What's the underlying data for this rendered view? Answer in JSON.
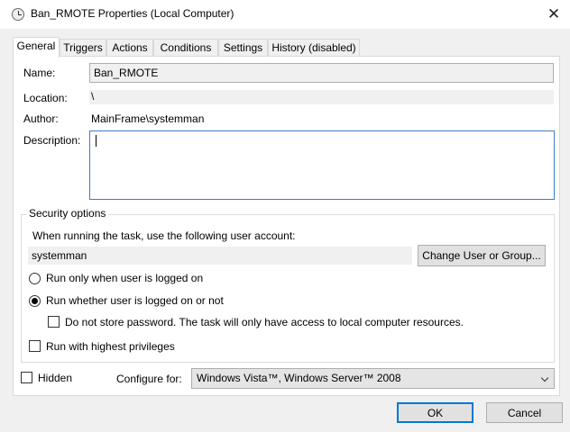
{
  "window": {
    "title": "Ban_RMOTE Properties (Local Computer)",
    "close_glyph": "✕",
    "icon": "scheduled-task-clock-icon"
  },
  "tabs": [
    {
      "label": "General",
      "active": true
    },
    {
      "label": "Triggers",
      "active": false
    },
    {
      "label": "Actions",
      "active": false
    },
    {
      "label": "Conditions",
      "active": false
    },
    {
      "label": "Settings",
      "active": false
    },
    {
      "label": "History (disabled)",
      "active": false
    }
  ],
  "general": {
    "name_label": "Name:",
    "name_value": "Ban_RMOTE",
    "location_label": "Location:",
    "location_value": "\\",
    "author_label": "Author:",
    "author_value": "MainFrame\\systemman",
    "description_label": "Description:",
    "description_value": ""
  },
  "security": {
    "legend": "Security options",
    "account_prompt": "When running the task, use the following user account:",
    "user_account": "systemman",
    "change_user_button": "Change User or Group...",
    "radio_logged_on": {
      "label": "Run only when user is logged on",
      "checked": false
    },
    "radio_whether": {
      "label": "Run whether user is logged on or not",
      "checked": true
    },
    "do_not_store_password": {
      "label": "Do not store password.  The task will only have access to local computer resources.",
      "checked": false
    },
    "highest_privileges": {
      "label": "Run with highest privileges",
      "checked": false
    }
  },
  "bottom": {
    "hidden": {
      "label": "Hidden",
      "checked": false
    },
    "configure_for_label": "Configure for:",
    "configure_for_value": "Windows Vista™, Windows Server™ 2008"
  },
  "buttons": {
    "ok": "OK",
    "cancel": "Cancel"
  },
  "colors": {
    "focus_border": "#3d7cc9",
    "default_button_border": "#0078d7",
    "window_bg": "#f0f0f0"
  }
}
